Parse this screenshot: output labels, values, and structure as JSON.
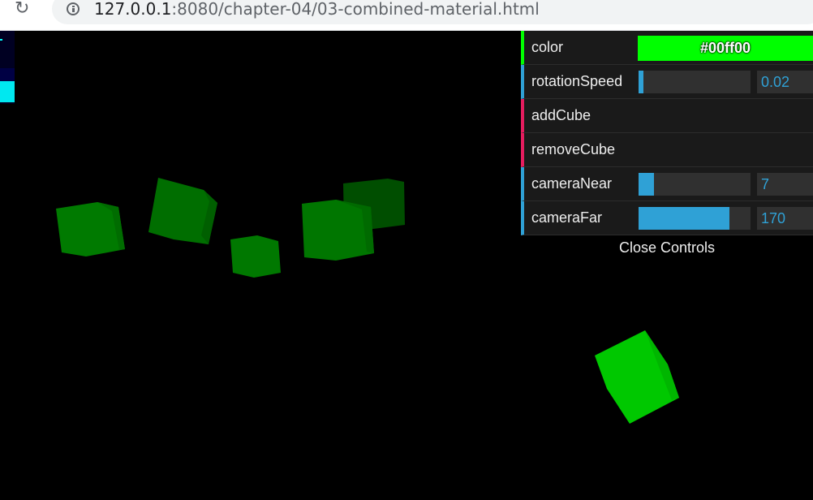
{
  "browser": {
    "url_host": "127.0.0.1",
    "url_rest": ":8080/chapter-04/03-combined-material.html"
  },
  "gui": {
    "controls": [
      {
        "label": "color",
        "type": "color",
        "value": "#00ff00"
      },
      {
        "label": "rotationSpeed",
        "type": "slider",
        "value": "0.02",
        "fraction": 0.04
      },
      {
        "label": "addCube",
        "type": "function"
      },
      {
        "label": "removeCube",
        "type": "function"
      },
      {
        "label": "cameraNear",
        "type": "slider",
        "value": "7",
        "fraction": 0.14
      },
      {
        "label": "cameraFar",
        "type": "slider",
        "value": "170",
        "fraction": 0.81
      }
    ],
    "close_label": "Close Controls"
  },
  "colors": {
    "scene_background": "#000000",
    "cube_color": "#00ff00",
    "slider_accent": "#2fa1d6",
    "function_accent": "#e61d5f"
  }
}
